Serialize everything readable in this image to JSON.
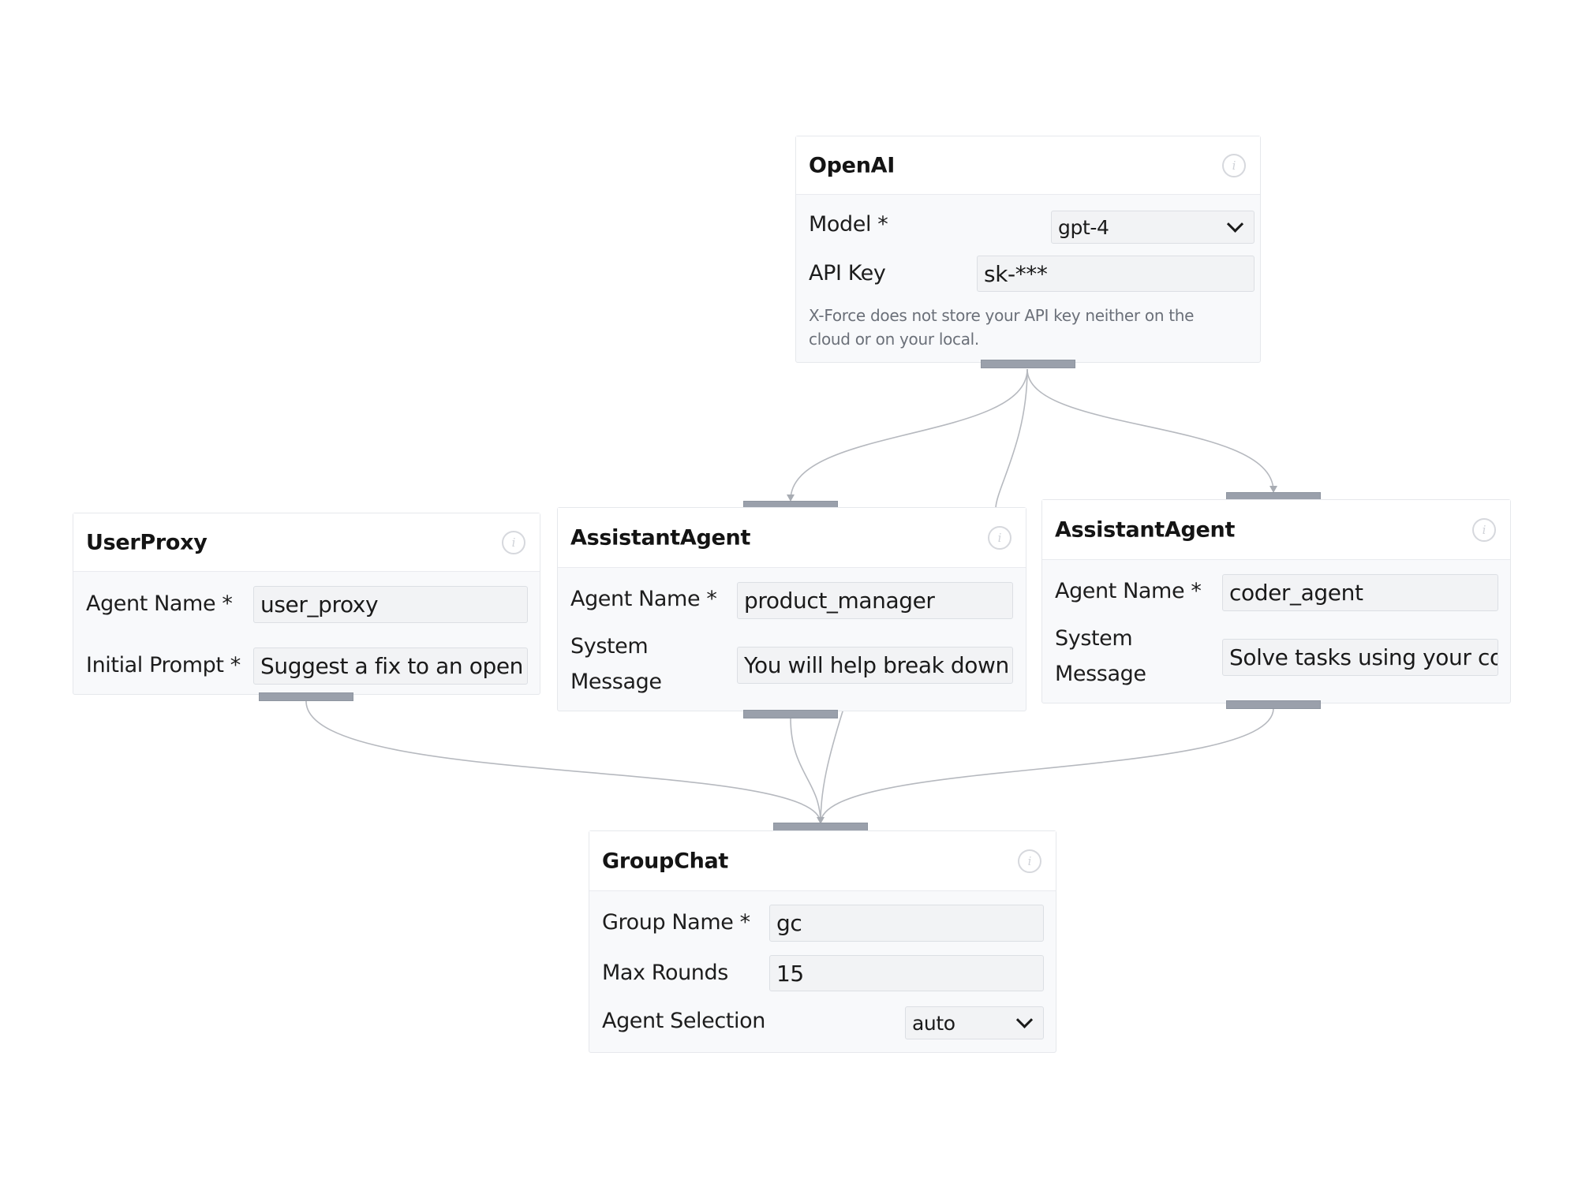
{
  "canvas": {
    "edge_color": "#b6b9bf",
    "handle_color": "#9aa0ab",
    "node_border_color": "#e6e8ec",
    "node_body_color": "#f8f9fb",
    "input_bg_color": "#f2f3f5"
  },
  "nodes": {
    "openai": {
      "title": "OpenAI",
      "info_icon": "info-icon",
      "fields": {
        "model": {
          "label": "Model *",
          "value": "gpt-4",
          "type": "select"
        },
        "api_key": {
          "label": "API Key",
          "value": "sk-***",
          "type": "text"
        }
      },
      "helper_text": "X-Force does not store your API key neither on the cloud or on your local."
    },
    "user_proxy": {
      "title": "UserProxy",
      "info_icon": "info-icon",
      "fields": {
        "agent_name": {
          "label": "Agent Name *",
          "value": "user_proxy",
          "type": "text"
        },
        "initial_prompt": {
          "label": "Initial Prompt *",
          "value": "Suggest a fix to an open",
          "type": "text"
        }
      }
    },
    "assistant_pm": {
      "title": "AssistantAgent",
      "info_icon": "info-icon",
      "fields": {
        "agent_name": {
          "label": "Agent Name *",
          "value": "product_manager",
          "type": "text"
        },
        "system_message": {
          "label_line1": "System",
          "label_line2": "Message",
          "value": "You will help break down",
          "type": "text"
        }
      }
    },
    "assistant_coder": {
      "title": "AssistantAgent",
      "info_icon": "info-icon",
      "fields": {
        "agent_name": {
          "label": "Agent Name *",
          "value": "coder_agent",
          "type": "text"
        },
        "system_message": {
          "label_line1": "System",
          "label_line2": "Message",
          "value": "Solve tasks using your co",
          "type": "text"
        }
      }
    },
    "group_chat": {
      "title": "GroupChat",
      "info_icon": "info-icon",
      "fields": {
        "group_name": {
          "label": "Group Name *",
          "value": "gc",
          "type": "text"
        },
        "max_rounds": {
          "label": "Max Rounds",
          "value": "15",
          "type": "text"
        },
        "agent_selection": {
          "label": "Agent Selection",
          "value": "auto",
          "type": "select"
        }
      }
    }
  },
  "edges": [
    {
      "from": "openai",
      "to": "assistant_pm"
    },
    {
      "from": "openai",
      "to": "assistant_coder"
    },
    {
      "from": "openai",
      "to": "group_chat"
    },
    {
      "from": "user_proxy",
      "to": "group_chat"
    },
    {
      "from": "assistant_pm",
      "to": "group_chat"
    },
    {
      "from": "assistant_coder",
      "to": "group_chat"
    }
  ]
}
